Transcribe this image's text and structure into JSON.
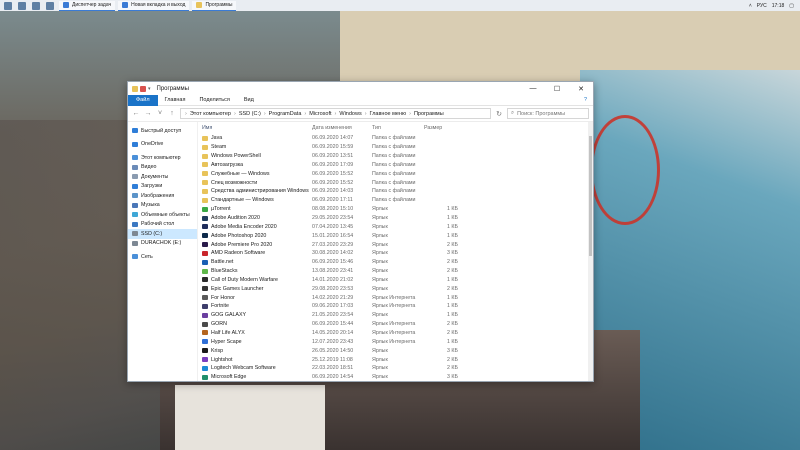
{
  "taskbar": {
    "apps": [
      {
        "label": "Диспетчер задач"
      },
      {
        "label": "Новая вкладка и выход"
      },
      {
        "label": "Программы"
      }
    ],
    "lang": "РУС",
    "time": "17:18"
  },
  "window": {
    "title": "Программы",
    "ribbon": {
      "file": "Файл",
      "tabs": [
        "Главная",
        "Поделиться",
        "Вид"
      ],
      "help": "?"
    },
    "path": [
      "Этот компьютер",
      "SSD (C:)",
      "ProgramData",
      "Microsoft",
      "Windows",
      "Главное меню",
      "Программы"
    ],
    "search_placeholder": "Поиск: Программы",
    "sidebar": [
      {
        "label": "Быстрый доступ",
        "icon": "star-icon",
        "color": "#2f7ed8"
      },
      {
        "gap": true
      },
      {
        "label": "OneDrive",
        "icon": "cloud-icon",
        "color": "#2f7ed8"
      },
      {
        "gap": true
      },
      {
        "label": "Этот компьютер",
        "icon": "computer-icon",
        "color": "#4a90d9"
      },
      {
        "label": "Видео",
        "icon": "video-icon",
        "color": "#6b8bb8"
      },
      {
        "label": "Документы",
        "icon": "document-icon",
        "color": "#8a9bb0"
      },
      {
        "label": "Загрузки",
        "icon": "download-icon",
        "color": "#2f7ed8"
      },
      {
        "label": "Изображения",
        "icon": "image-icon",
        "color": "#5c94c9"
      },
      {
        "label": "Музыка",
        "icon": "music-icon",
        "color": "#4a77b8"
      },
      {
        "label": "Объемные объекты",
        "icon": "cube-icon",
        "color": "#3fa7d6"
      },
      {
        "label": "Рабочий стол",
        "icon": "desktop-icon",
        "color": "#3b78c2"
      },
      {
        "label": "SSD (C:)",
        "icon": "drive-icon",
        "color": "#7d8894",
        "selected": true
      },
      {
        "label": "DURACHOK (E:)",
        "icon": "drive-icon",
        "color": "#7d8894"
      },
      {
        "gap": true
      },
      {
        "label": "Сеть",
        "icon": "network-icon",
        "color": "#4a90d9"
      }
    ],
    "columns": {
      "name": "Имя",
      "date": "Дата изменения",
      "type": "Тип",
      "size": "Размер"
    },
    "files": [
      {
        "name": "Java",
        "date": "06.09.2020 14:07",
        "type": "Папка с файлами",
        "size": "",
        "icon": "folder-icon",
        "color": "#e8c35a"
      },
      {
        "name": "Steam",
        "date": "06.09.2020 15:59",
        "type": "Папка с файлами",
        "size": "",
        "icon": "folder-icon",
        "color": "#e8c35a"
      },
      {
        "name": "Windows PowerShell",
        "date": "06.09.2020 13:51",
        "type": "Папка с файлами",
        "size": "",
        "icon": "folder-icon",
        "color": "#e8c35a"
      },
      {
        "name": "Автозагрузка",
        "date": "06.09.2020 17:09",
        "type": "Папка с файлами",
        "size": "",
        "icon": "folder-icon",
        "color": "#e8c35a"
      },
      {
        "name": "Служебные — Windows",
        "date": "06.09.2020 15:52",
        "type": "Папка с файлами",
        "size": "",
        "icon": "folder-icon",
        "color": "#e8c35a"
      },
      {
        "name": "Спец возможности",
        "date": "06.09.2020 15:52",
        "type": "Папка с файлами",
        "size": "",
        "icon": "folder-icon",
        "color": "#e8c35a"
      },
      {
        "name": "Средства администрирования Windows",
        "date": "06.09.2020 14:03",
        "type": "Папка с файлами",
        "size": "",
        "icon": "folder-icon",
        "color": "#e8c35a"
      },
      {
        "name": "Стандартные — Windows",
        "date": "06.09.2020 17:11",
        "type": "Папка с файлами",
        "size": "",
        "icon": "folder-icon",
        "color": "#e8c35a"
      },
      {
        "name": "µTorrent",
        "date": "08.08.2020 15:10",
        "type": "Ярлык",
        "size": "1 КБ",
        "icon": "app-icon",
        "color": "#3aa845"
      },
      {
        "name": "Adobe Audition 2020",
        "date": "29.05.2020 23:54",
        "type": "Ярлык",
        "size": "1 КБ",
        "icon": "app-icon",
        "color": "#1f3c5b"
      },
      {
        "name": "Adobe Media Encoder 2020",
        "date": "07.04.2020 13:45",
        "type": "Ярлык",
        "size": "1 КБ",
        "icon": "app-icon",
        "color": "#1f2d5b"
      },
      {
        "name": "Adobe Photoshop 2020",
        "date": "15.01.2020 16:54",
        "type": "Ярлык",
        "size": "1 КБ",
        "icon": "app-icon",
        "color": "#0e2a4a"
      },
      {
        "name": "Adobe Premiere Pro 2020",
        "date": "27.03.2020 23:29",
        "type": "Ярлык",
        "size": "2 КБ",
        "icon": "app-icon",
        "color": "#2a1a4a"
      },
      {
        "name": "AMD Radeon Software",
        "date": "30.08.2020 14:02",
        "type": "Ярлык",
        "size": "3 КБ",
        "icon": "app-icon",
        "color": "#c9252b"
      },
      {
        "name": "Battle.net",
        "date": "06.09.2020 15:46",
        "type": "Ярлык",
        "size": "2 КБ",
        "icon": "app-icon",
        "color": "#1a5fb4"
      },
      {
        "name": "BlueStacks",
        "date": "13.08.2020 23:41",
        "type": "Ярлык",
        "size": "2 КБ",
        "icon": "app-icon",
        "color": "#5fb84a"
      },
      {
        "name": "Call of Duty Modern Warfare",
        "date": "14.01.2020 21:02",
        "type": "Ярлык",
        "size": "1 КБ",
        "icon": "app-icon",
        "color": "#2b2b2b"
      },
      {
        "name": "Epic Games Launcher",
        "date": "29.08.2020 23:53",
        "type": "Ярлык",
        "size": "2 КБ",
        "icon": "app-icon",
        "color": "#333333"
      },
      {
        "name": "For Honor",
        "date": "14.02.2020 21:29",
        "type": "Ярлык Интернета",
        "size": "1 КБ",
        "icon": "app-icon",
        "color": "#5a5a5a"
      },
      {
        "name": "Fortnite",
        "date": "09.06.2020 17:03",
        "type": "Ярлык Интернета",
        "size": "1 КБ",
        "icon": "app-icon",
        "color": "#3d3d6b"
      },
      {
        "name": "GOG GALAXY",
        "date": "21.05.2020 23:54",
        "type": "Ярлык",
        "size": "1 КБ",
        "icon": "app-icon",
        "color": "#6b3fa0"
      },
      {
        "name": "GORN",
        "date": "06.09.2020 15:44",
        "type": "Ярлык Интернета",
        "size": "2 КБ",
        "icon": "app-icon",
        "color": "#4a4a4a"
      },
      {
        "name": "Half Life ALYX",
        "date": "14.05.2020 20:14",
        "type": "Ярлык Интернета",
        "size": "2 КБ",
        "icon": "app-icon",
        "color": "#b5651d"
      },
      {
        "name": "Hyper Scape",
        "date": "12.07.2020 23:43",
        "type": "Ярлык Интернета",
        "size": "1 КБ",
        "icon": "app-icon",
        "color": "#2f6fd6"
      },
      {
        "name": "Krisp",
        "date": "26.05.2020 14:50",
        "type": "Ярлык",
        "size": "3 КБ",
        "icon": "app-icon",
        "color": "#1a1a1a"
      },
      {
        "name": "Lightshot",
        "date": "25.12.2019 11:08",
        "type": "Ярлык",
        "size": "2 КБ",
        "icon": "app-icon",
        "color": "#7a3fbf"
      },
      {
        "name": "Logitech Webcam Software",
        "date": "22.03.2020 18:51",
        "type": "Ярлык",
        "size": "2 КБ",
        "icon": "app-icon",
        "color": "#1b8bd6"
      },
      {
        "name": "Microsoft Edge",
        "date": "06.09.2020 14:54",
        "type": "Ярлык",
        "size": "3 КБ",
        "icon": "app-icon",
        "color": "#1f8f6b"
      }
    ]
  }
}
